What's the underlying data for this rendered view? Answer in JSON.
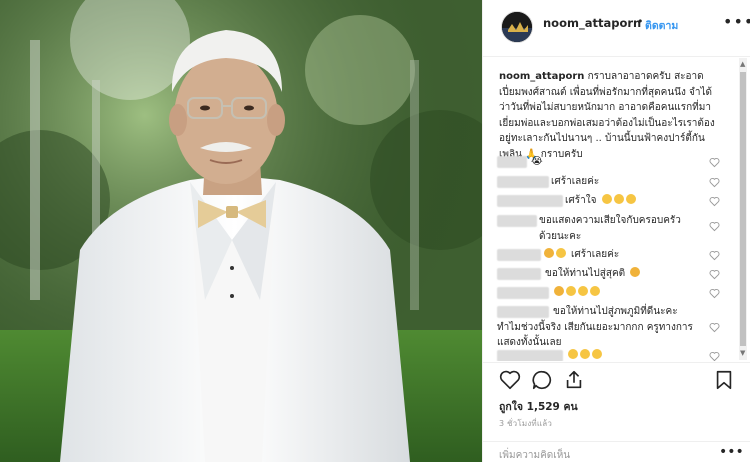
{
  "post": {
    "username": "noom_attaporn",
    "follow_dot": "•",
    "follow_label": "ติดตาม",
    "more_icon": "more-horizontal-icon",
    "caption_user": "noom_attaporn",
    "caption_text": "กราบลาอาอาดครับ สะอาดเปี่ยมพงศ์สาณต์ เพื่อนที่พ่อรักมากที่สุดคนนึง จำได้ว่าวันที่พ่อไม่สบายหนักมาก อาอาดคือคนแรกที่มาเยี่ยมพ่อและบอกพ่อเสมอว่าต้องไม่เป็นอะไรเราต้องอยู่ทะเลาะกันไปนานๆ .. บ้านนี้บนฟ้าคงปาร์ตี้กันเพลิน 🙏 กราบครับ",
    "likes": "ถูกใจ 1,529 คน",
    "time_ago": "3 ชั่วโมงที่แล้ว",
    "add_comment_placeholder": "เพิ่มความคิดเห็น",
    "add_comment_more": "•••"
  },
  "comments": [
    {
      "text": "😭",
      "emoji": [
        "sad"
      ]
    },
    {
      "text": "เศร้าเลยค่ะ",
      "emoji": []
    },
    {
      "text": "เศร้าใจ",
      "emoji": [
        "sad",
        "sad",
        "sad"
      ]
    },
    {
      "text": "ขอแสดงความเสียใจกับครอบครัวด้วยนะคะ",
      "emoji": []
    },
    {
      "text": "เศร้าเลยค่ะ",
      "emoji": [
        "pray",
        "sad"
      ]
    },
    {
      "text": "ขอให้ท่านไปสู่สุคติ",
      "emoji": [
        "pray"
      ]
    },
    {
      "text": "",
      "emoji": [
        "pray",
        "sad",
        "sad",
        "sad"
      ]
    },
    {
      "text": "ขอให้ท่านไปสู่ภพภูมิที่ดีนะคะ ทำไมช่วงนี้จริง เสียกันเยอะมากกก ครูทางการแสดงทั้งนั้นเลย",
      "emoji": []
    },
    {
      "text": "",
      "emoji": [
        "sad",
        "sad",
        "sad"
      ]
    }
  ],
  "colors": {
    "follow": "#3897f0",
    "text": "#262626",
    "muted": "#999999",
    "sad_emoji": "#f6c543"
  },
  "icons": [
    "heart-icon",
    "comment-icon",
    "share-icon",
    "bookmark-icon"
  ]
}
